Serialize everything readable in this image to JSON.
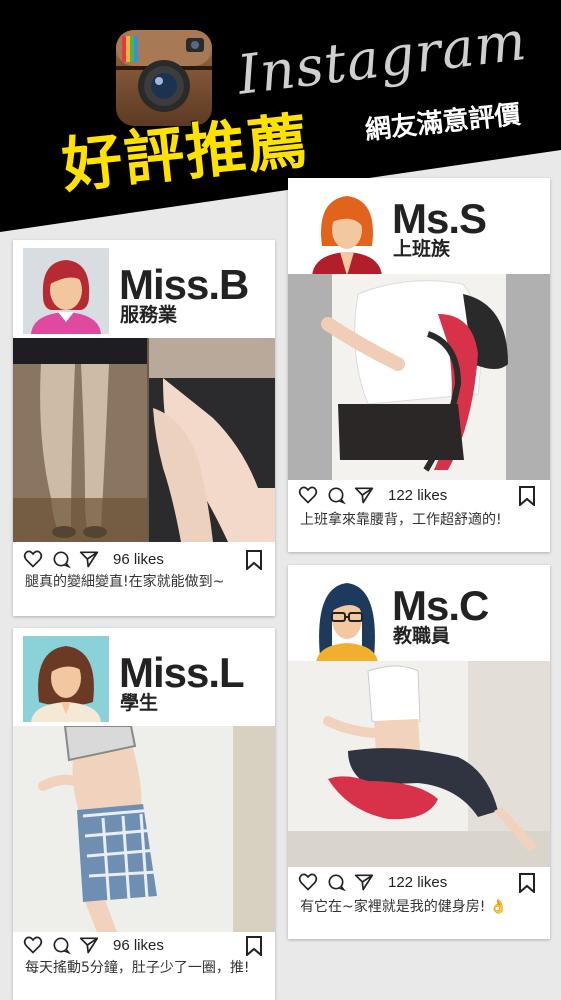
{
  "header": {
    "brand": "Instagram",
    "title": "好評推薦",
    "subtitle": "網友滿意評價"
  },
  "posts": [
    {
      "name": "Miss.B",
      "job": "服務業",
      "likes": "96 likes",
      "caption": "腿真的變細變直!在家就能做到~"
    },
    {
      "name": "Ms.S",
      "job": "上班族",
      "likes": "122 likes",
      "caption": "上班拿來靠腰背，工作超舒適的!"
    },
    {
      "name": "Miss.L",
      "job": "學生",
      "likes": "96 likes",
      "caption": "每天搖動5分鐘，肚子少了一圈，推!"
    },
    {
      "name": "Ms.C",
      "job": "教職員",
      "likes": "122 likes",
      "caption": "有它在~家裡就是我的健身房! 👌"
    }
  ],
  "icons": {
    "heart": "heart-icon",
    "comment": "comment-icon",
    "share": "send-icon",
    "save": "bookmark-icon"
  },
  "colors": {
    "title_yellow": "#ffe200",
    "header_black": "#000000",
    "cushion_red": "#d8324a"
  }
}
